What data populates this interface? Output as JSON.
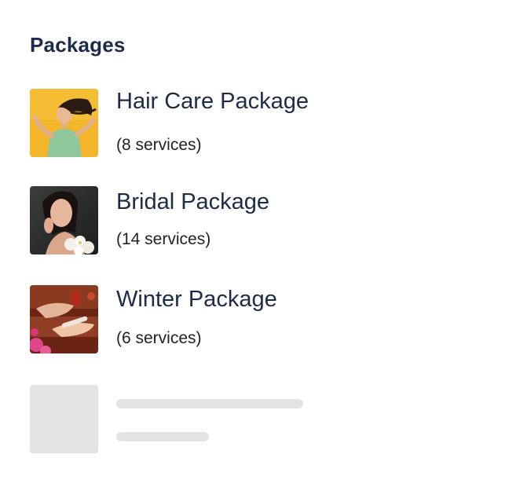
{
  "section": {
    "title": "Packages"
  },
  "packages": [
    {
      "name": "Hair Care Package",
      "services": "(8 services)",
      "thumbnail": "hair-care-photo"
    },
    {
      "name": "Bridal Package",
      "services": "(14 services)",
      "thumbnail": "bridal-photo"
    },
    {
      "name": "Winter Package",
      "services": "(6 services)",
      "thumbnail": "manicure-photo"
    }
  ],
  "colors": {
    "title": "#1c2b4a",
    "text": "#222222",
    "skeleton": "#e4e4e4",
    "background": "#ffffff"
  }
}
